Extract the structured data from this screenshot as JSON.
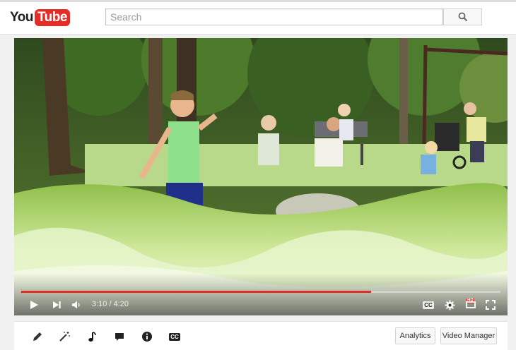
{
  "header": {
    "logo_you": "You",
    "logo_tube": "Tube",
    "search_placeholder": "Search"
  },
  "player": {
    "current_time": "3:10",
    "separator": " / ",
    "duration": "4:20",
    "progress_fraction": 0.73,
    "cc_label": "CC",
    "hd_badge": "HD"
  },
  "toolbar": {
    "tools": [
      "pencil-icon",
      "magic-wand-icon",
      "music-note-icon",
      "speech-bubble-icon",
      "info-icon",
      "cc-icon"
    ],
    "cc_label": "CC",
    "analytics_label": "Analytics",
    "video_manager_label": "Video Manager"
  },
  "colors": {
    "brand_red": "#e52d27",
    "toolbar_bg": "#ffffff",
    "page_bg": "#f1f1f1"
  }
}
